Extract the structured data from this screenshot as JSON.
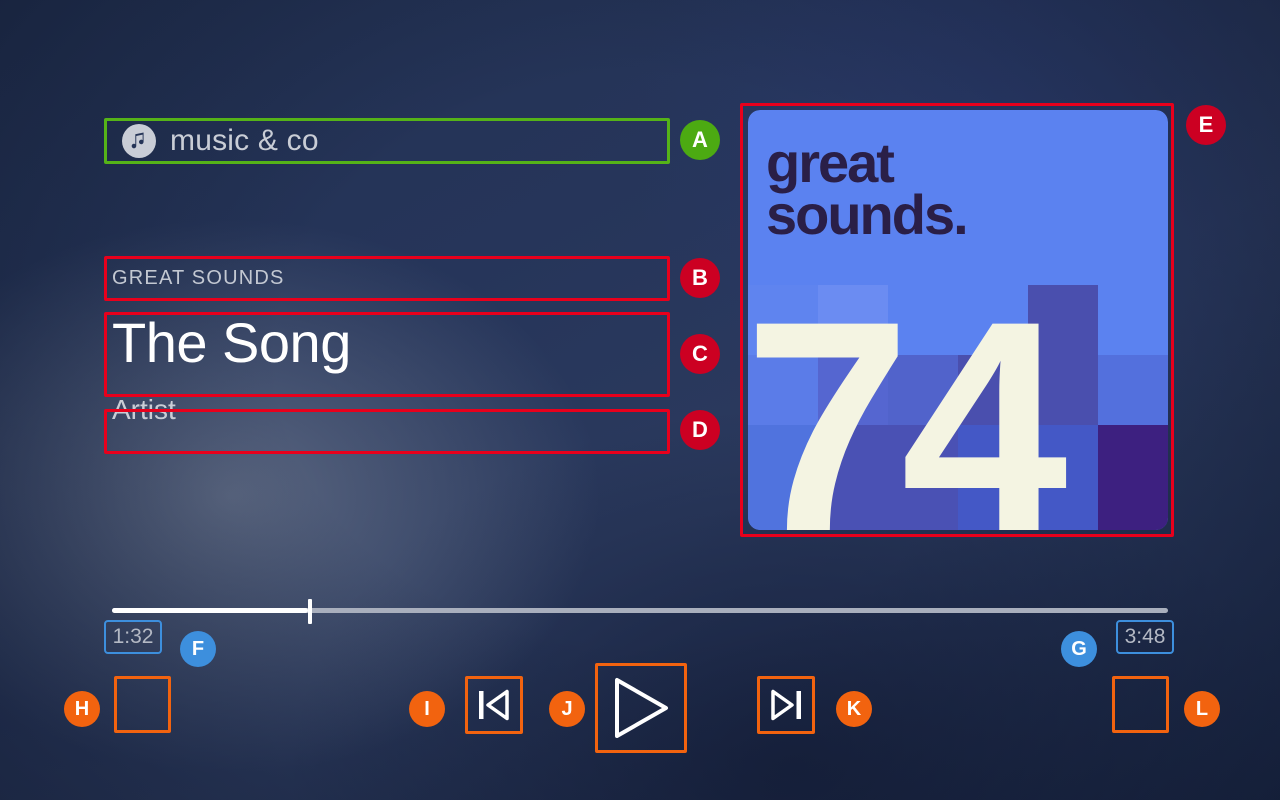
{
  "app": {
    "name": "music & co",
    "icon": "music-note-icon"
  },
  "now_playing": {
    "album_label": "GREAT SOUNDS",
    "track_title": "The Song",
    "artist": "Artist"
  },
  "album_art": {
    "headline_line1": "great",
    "headline_line2": "sounds.",
    "big_number": "74",
    "bg_color": "#5b82f0",
    "ink_color": "#2a1f47",
    "cream_color": "#f4f4e2",
    "tile_colors": [
      "#5b82f0",
      "#6b8cf2",
      "#4d62c2",
      "#4a4fae",
      "#4a46a8",
      "#3d2080"
    ]
  },
  "playback": {
    "elapsed": "1:32",
    "remaining": "3:48",
    "progress_percent": 18.6
  },
  "controls": {
    "shuffle": {
      "label": "shuffle-button",
      "icon": "blank-icon"
    },
    "previous": {
      "label": "previous-track-button",
      "icon": "skip-previous-icon"
    },
    "play": {
      "label": "play-button",
      "icon": "play-icon"
    },
    "next": {
      "label": "next-track-button",
      "icon": "skip-next-icon"
    },
    "repeat": {
      "label": "repeat-button",
      "icon": "blank-icon"
    }
  },
  "annotations": {
    "colors": {
      "red": "#e8001c",
      "green": "#55b318",
      "orange": "#f2630f",
      "blue": "#3d8fdd",
      "badge_red": "#cc0022",
      "badge_green": "#4caa12",
      "badge_blue": "#3d8fdd",
      "badge_orange": "#f2630f"
    },
    "markers": [
      {
        "id": "A",
        "target": "app-name-field"
      },
      {
        "id": "B",
        "target": "album-label-field"
      },
      {
        "id": "C",
        "target": "track-title-field"
      },
      {
        "id": "D",
        "target": "artist-name-field"
      },
      {
        "id": "E",
        "target": "album-art"
      },
      {
        "id": "F",
        "target": "elapsed-time"
      },
      {
        "id": "G",
        "target": "remaining-time"
      },
      {
        "id": "H",
        "target": "shuffle-button"
      },
      {
        "id": "I",
        "target": "previous-track-button"
      },
      {
        "id": "J",
        "target": "play-button"
      },
      {
        "id": "K",
        "target": "next-track-button"
      },
      {
        "id": "L",
        "target": "repeat-button"
      }
    ]
  }
}
